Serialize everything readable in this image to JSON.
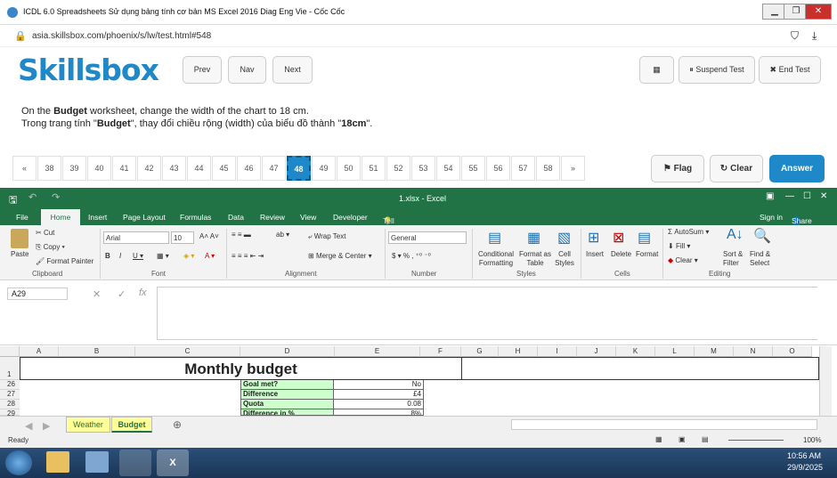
{
  "browser": {
    "title": "ICDL 6.0 Spreadsheets Sử dụng bảng tính cơ bản MS Excel 2016 Diag Eng Vie - Cốc Cốc",
    "url": "asia.skillsbox.com/phoenix/s/lw/test.html#548"
  },
  "test": {
    "logo": "Skillsbox",
    "prev": "Prev",
    "nav": "Nav",
    "next": "Next",
    "suspend": "Suspend Test",
    "end": "End Test",
    "question_en_pre": "On the ",
    "question_en_bold": "Budget",
    "question_en_post": " worksheet, change the width of the chart to 18 cm.",
    "question_vi_pre": "Trong trang tính \"",
    "question_vi_bold": "Budget",
    "question_vi_mid": "\", thay đổi chiều rộng (width) của biểu đồ thành \"",
    "question_vi_bold2": "18cm",
    "question_vi_post": "\".",
    "first": "«",
    "last": "»",
    "pages": [
      "38",
      "39",
      "40",
      "41",
      "42",
      "43",
      "44",
      "45",
      "46",
      "47",
      "48",
      "49",
      "50",
      "51",
      "52",
      "53",
      "54",
      "55",
      "56",
      "57",
      "58"
    ],
    "current": "48",
    "flag": "Flag",
    "clear": "Clear",
    "answer": "Answer"
  },
  "excel": {
    "title": "1.xlsx - Excel",
    "signin": "Sign in",
    "share": "Share",
    "tabs": [
      "File",
      "Home",
      "Insert",
      "Page Layout",
      "Formulas",
      "Data",
      "Review",
      "View",
      "Developer"
    ],
    "tellme": "Tell me what you want to do...",
    "ribbon": {
      "paste": "Paste",
      "cut": "Cut",
      "copy": "Copy",
      "fmtpainter": "Format Painter",
      "clipboard": "Clipboard",
      "font": "Arial",
      "size": "10",
      "fontgrp": "Font",
      "wrap": "Wrap Text",
      "merge": "Merge & Center",
      "alignment": "Alignment",
      "numfmt": "General",
      "number": "Number",
      "cond": "Conditional Formatting",
      "fmttable": "Format as Table",
      "cellstyles": "Cell Styles",
      "styles": "Styles",
      "insert": "Insert",
      "delete": "Delete",
      "format": "Format",
      "cells": "Cells",
      "autosum": "AutoSum",
      "fill": "Fill",
      "clear": "Clear",
      "sort": "Sort & Filter",
      "find": "Find & Select",
      "editing": "Editing"
    },
    "namebox": "A29",
    "cols": [
      "A",
      "B",
      "C",
      "D",
      "E",
      "F",
      "G",
      "H",
      "I",
      "J",
      "K",
      "L",
      "M",
      "N",
      "O"
    ],
    "title_cell": "Monthly budget",
    "rows": [
      {
        "n": "1"
      },
      {
        "n": "26",
        "label": "Goal met?",
        "value": "No"
      },
      {
        "n": "27",
        "label": "Difference",
        "value": "£4"
      },
      {
        "n": "28",
        "label": "Quota",
        "value": "0.08"
      },
      {
        "n": "29",
        "label": "Difference in %",
        "value": "8%"
      }
    ],
    "sheets": [
      "Weather",
      "Budget"
    ],
    "active_sheet": "Budget",
    "ready": "Ready",
    "zoom": "100%"
  },
  "taskbar": {
    "time": "10:56 AM",
    "date": "29/9/2025"
  }
}
